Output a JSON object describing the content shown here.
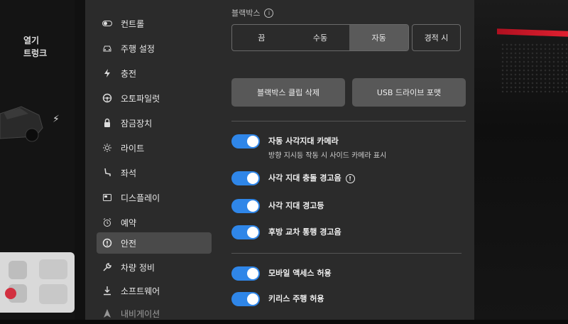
{
  "vehicle": {
    "labels": [
      "열기",
      "트렁크"
    ]
  },
  "sidebar": {
    "items": [
      {
        "label": "컨트롤",
        "icon": "toggle-icon"
      },
      {
        "label": "주행 설정",
        "icon": "car-icon"
      },
      {
        "label": "충전",
        "icon": "bolt-icon"
      },
      {
        "label": "오토파일럿",
        "icon": "steering-wheel-icon"
      },
      {
        "label": "잠금장치",
        "icon": "lock-icon"
      },
      {
        "label": "라이트",
        "icon": "sun-icon"
      },
      {
        "label": "좌석",
        "icon": "seat-icon"
      },
      {
        "label": "디스플레이",
        "icon": "display-icon"
      },
      {
        "label": "예약",
        "icon": "alarm-icon"
      },
      {
        "label": "안전",
        "icon": "alert-circle-icon",
        "active": true
      },
      {
        "label": "차량 정비",
        "icon": "wrench-icon"
      },
      {
        "label": "소프트웨어",
        "icon": "download-icon"
      },
      {
        "label": "내비게이션",
        "icon": "navigation-icon"
      }
    ]
  },
  "dashcam": {
    "section_label": "블랙박스",
    "options": [
      "끔",
      "수동",
      "자동"
    ],
    "selected": "자동",
    "crash_label": "경적 시",
    "delete_clips_label": "블랙박스 클립 삭제",
    "format_usb_label": "USB 드라이브 포맷"
  },
  "toggles": [
    {
      "title": "자동 사각지대 카메라",
      "subtitle": "방향 지시등 작동 시 사이드 카메라 표시",
      "on": true
    },
    {
      "title": "사각 지대 충돌 경고음",
      "info": true,
      "on": true
    },
    {
      "title": "사각 지대 경고등",
      "on": true
    },
    {
      "title": "후방 교차 통행 경고음",
      "on": true
    },
    {
      "title": "모바일 액세스 허용",
      "on": true
    },
    {
      "title": "키리스 주행 허용",
      "on": true
    }
  ],
  "colors": {
    "toggle_on": "#2f86e8",
    "screen_bg": "#2b2b2b",
    "active_nav": "#4a4a4a",
    "accent_red": "#e02030"
  }
}
